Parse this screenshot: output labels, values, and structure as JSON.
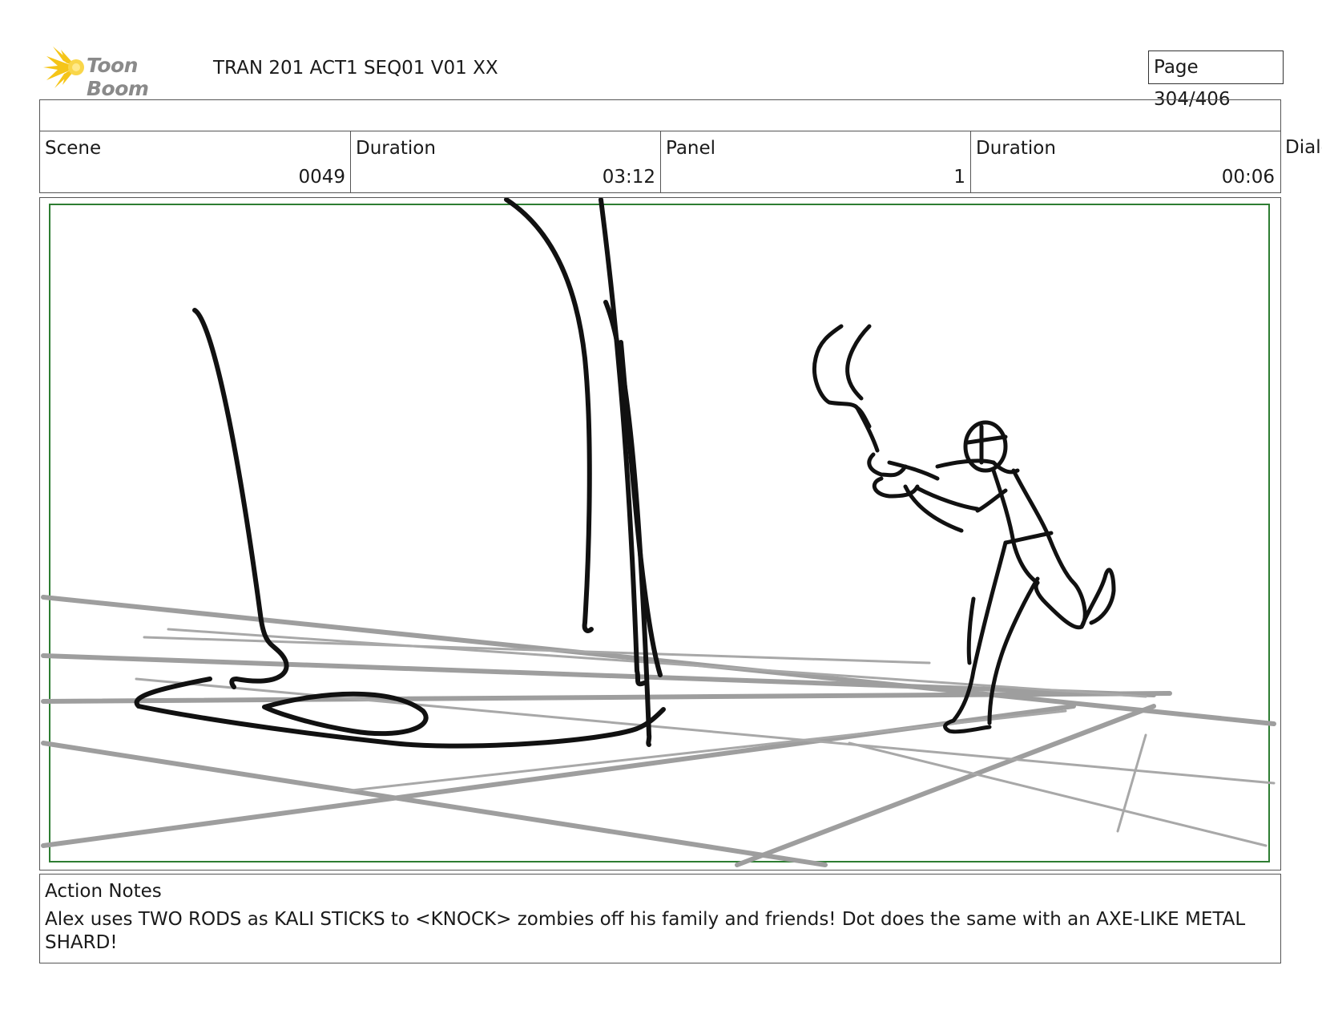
{
  "header": {
    "logo_text": "Toon Boom",
    "logo_icon": "starburst-logo-icon",
    "title": "TRAN 201 ACT1 SEQ01 V01 XX",
    "page": "Page 304/406"
  },
  "info": {
    "scene_label": "Scene",
    "scene_value": "0049",
    "scene_duration_label": "Duration",
    "scene_duration_value": "03:12",
    "panel_label": "Panel",
    "panel_value": "1",
    "panel_duration_label": "Duration",
    "panel_duration_value": "00:06",
    "dialog_label": "Dialo"
  },
  "panel": {
    "frame_color": "#2e7d32",
    "sketch_color": "#111111",
    "guide_color": "#9e9e9e"
  },
  "notes": {
    "label": "Action Notes",
    "text": "Alex uses TWO RODS as KALI STICKS to <KNOCK> zombies off his family and friends! Dot does the same with an AXE-LIKE METAL SHARD!"
  },
  "colors": {
    "logo_accent": "#f5c518"
  }
}
